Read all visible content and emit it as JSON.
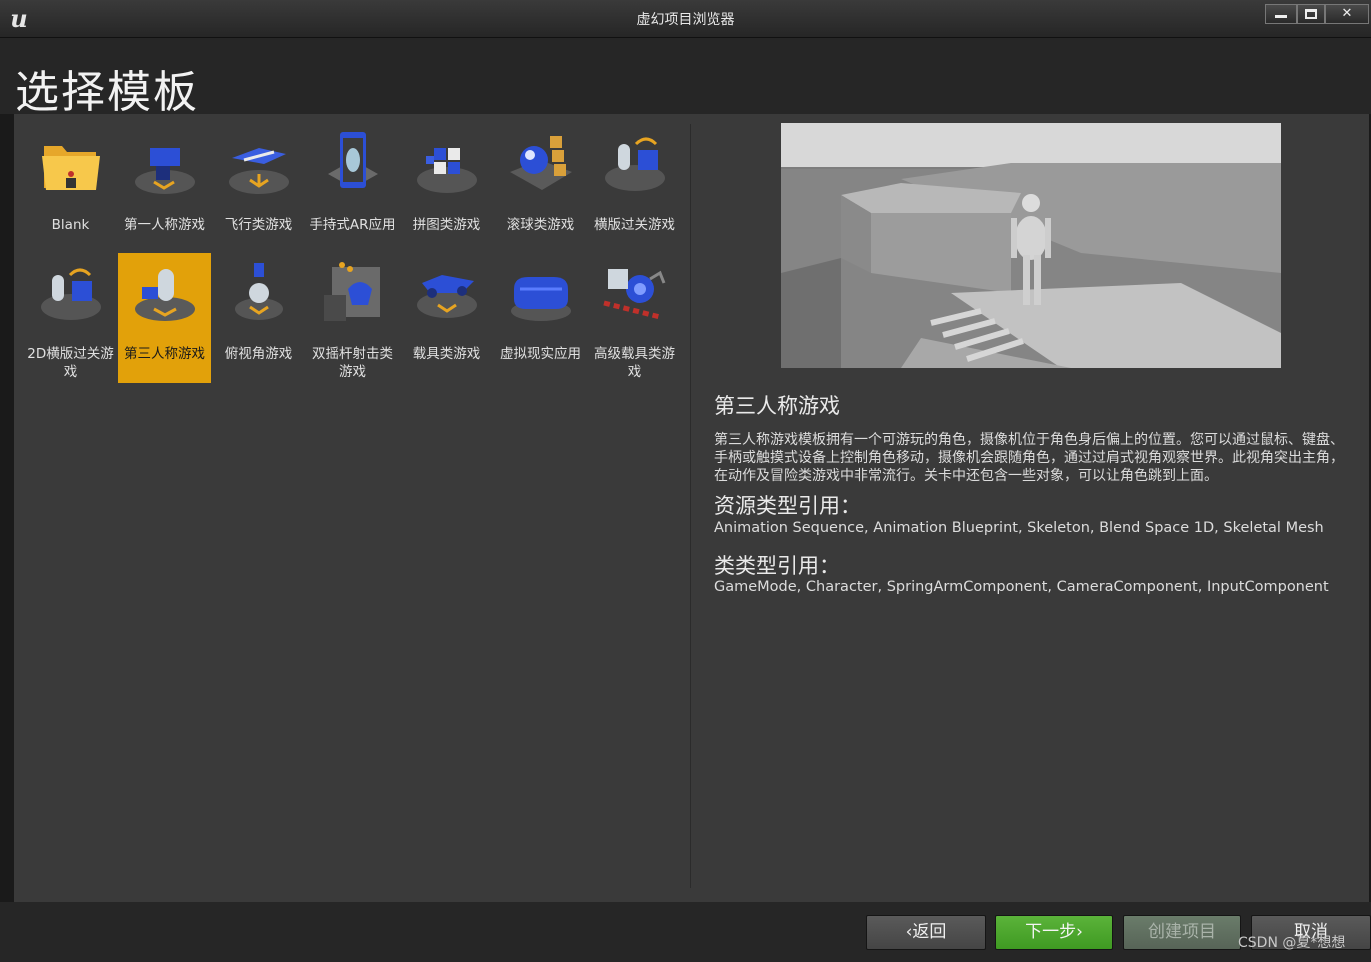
{
  "window": {
    "logo_text": "u",
    "title": "虚幻项目浏览器",
    "minimize_icon": "minimize-icon",
    "maximize_icon": "maximize-icon",
    "close_label": "✕"
  },
  "header": {
    "title": "选择模板"
  },
  "templates": [
    {
      "label": "Blank",
      "icon": "folder-icon",
      "selected": false
    },
    {
      "label": "第一人称游戏",
      "icon": "first-person-icon",
      "selected": false
    },
    {
      "label": "飞行类游戏",
      "icon": "flying-icon",
      "selected": false
    },
    {
      "label": "手持式AR应用",
      "icon": "handheld-ar-icon",
      "selected": false
    },
    {
      "label": "拼图类游戏",
      "icon": "puzzle-icon",
      "selected": false
    },
    {
      "label": "滚球类游戏",
      "icon": "rolling-icon",
      "selected": false
    },
    {
      "label": "横版过关游戏",
      "icon": "side-scroller-icon",
      "selected": false
    },
    {
      "label": "2D横版过关游戏",
      "icon": "2d-side-scroller-icon",
      "selected": false
    },
    {
      "label": "第三人称游戏",
      "icon": "third-person-icon",
      "selected": true
    },
    {
      "label": "俯视角游戏",
      "icon": "top-down-icon",
      "selected": false
    },
    {
      "label": "双摇杆射击类游戏",
      "icon": "twin-stick-shooter-icon",
      "selected": false
    },
    {
      "label": "载具类游戏",
      "icon": "vehicle-icon",
      "selected": false
    },
    {
      "label": "虚拟现实应用",
      "icon": "vr-icon",
      "selected": false
    },
    {
      "label": "高级载具类游戏",
      "icon": "advanced-vehicle-icon",
      "selected": false
    }
  ],
  "details": {
    "title": "第三人称游戏",
    "description": "第三人称游戏模板拥有一个可游玩的角色，摄像机位于角色身后偏上的位置。您可以通过鼠标、键盘、手柄或触摸式设备上控制角色移动，摄像机会跟随角色，通过过肩式视角观察世界。此视角突出主角，在动作及冒险类游戏中非常流行。关卡中还包含一些对象，可以让角色跳到上面。",
    "asset_refs_title": "资源类型引用：",
    "asset_refs": "Animation Sequence, Animation Blueprint, Skeleton, Blend Space 1D, Skeletal Mesh",
    "class_refs_title": "类类型引用：",
    "class_refs": "GameMode, Character, SpringArmComponent, CameraComponent, InputComponent"
  },
  "buttons": {
    "back": "‹返回",
    "next": "下一步›",
    "create": "创建项目",
    "cancel": "取消"
  },
  "watermark": "CSDN @夏*想想",
  "colors": {
    "selected": "#e2a10a",
    "next_button": "#4ca62e",
    "panel": "#3a3a3a"
  }
}
